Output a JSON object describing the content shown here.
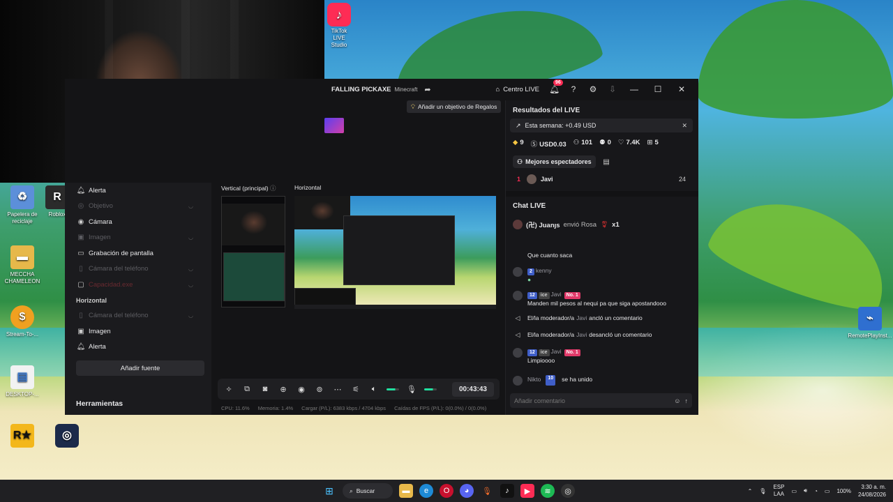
{
  "desktop": {
    "icons": [
      {
        "label": "Papelera de reciclaje",
        "glyph": "♻",
        "color": "#4a7fd6"
      },
      {
        "label": "Roblox",
        "glyph": "R",
        "color": "#2b2b2b"
      },
      {
        "label": "MECCHA CHAMELEON",
        "glyph": "▬",
        "color": "#e7b84a"
      },
      {
        "label": "Stream-To-...",
        "glyph": "$",
        "color": "#f0a020"
      },
      {
        "label": "DESKTOP-...",
        "glyph": "▤",
        "color": "#3a78d0"
      },
      {
        "label": "Rockstar",
        "glyph": "R★",
        "color": "#f3b71b"
      },
      {
        "label": "RemotePlayInst...",
        "glyph": "⌁",
        "color": "#2f6fd0"
      }
    ],
    "tiktok_icon_label": "TikTok LIVE Studio"
  },
  "titlebar": {
    "title": "FALLING PICKAXE",
    "game": "Minecraft",
    "centro_label": "Centro LIVE",
    "notif_count": "96"
  },
  "goal_button": "Añadir un objetivo de Regalos",
  "sources": {
    "vertical_items": [
      {
        "label": "Alerta",
        "icon": "bell-icon",
        "glyph": "🔔︎",
        "state": "normal"
      },
      {
        "label": "Objetivo",
        "icon": "target-icon",
        "glyph": "◎",
        "state": "dim"
      },
      {
        "label": "Cámara",
        "icon": "camera-icon",
        "glyph": "◉",
        "state": "normal"
      },
      {
        "label": "Imagen",
        "icon": "image-icon",
        "glyph": "▣",
        "state": "dim"
      },
      {
        "label": "Grabación de pantalla",
        "icon": "monitor-icon",
        "glyph": "▭",
        "state": "normal"
      },
      {
        "label": "Cámara del teléfono",
        "icon": "phone-icon",
        "glyph": "▯",
        "state": "dim"
      },
      {
        "label": "Capacidad.exe",
        "icon": "window-icon",
        "glyph": "▢",
        "state": "red"
      }
    ],
    "horizontal_label": "Horizontal",
    "horizontal_items": [
      {
        "label": "Cámara del teléfono",
        "icon": "phone-icon",
        "glyph": "▯",
        "state": "dim"
      },
      {
        "label": "Imagen",
        "icon": "image-icon",
        "glyph": "▣",
        "state": "normal"
      },
      {
        "label": "Alerta",
        "icon": "bell-icon",
        "glyph": "🔔︎",
        "state": "normal"
      }
    ],
    "add_source": "Añadir fuente",
    "tools": "Herramientas"
  },
  "previews": {
    "vertical_label": "Vertical (principal)",
    "horizontal_label": "Horizontal"
  },
  "controls": {
    "timer": "00:43:43"
  },
  "statusbar": {
    "cpu": "CPU: 11.6%",
    "mem": "Memoria: 1.4%",
    "load": "Cargar (P/L): 6383 kbps / 4704 kbps",
    "fps": "Caídas de FPS (P/L): 0(0.0%) / 0(0.0%)"
  },
  "results": {
    "title": "Resultados del LIVE",
    "week": "Esta semana: +0.49 USD",
    "stats": [
      {
        "icon": "diamond-icon",
        "glyph": "◆",
        "value": "9"
      },
      {
        "icon": "coin-icon",
        "glyph": "Ⓢ",
        "value": "USD0.03"
      },
      {
        "icon": "viewers-icon",
        "glyph": "⚇",
        "value": "101"
      },
      {
        "icon": "follow-icon",
        "glyph": "⚉",
        "value": "0"
      },
      {
        "icon": "heart-icon",
        "glyph": "♡",
        "value": "7.4K"
      },
      {
        "icon": "gift-icon",
        "glyph": "⊞",
        "value": "5"
      }
    ],
    "best_label": "Mejores espectadores",
    "top_viewer": {
      "rank": "1",
      "name": "Javi",
      "count": "24"
    }
  },
  "chat": {
    "title": "Chat LIVE",
    "gift": {
      "user": "(卍) Juanȷs",
      "action": "envió Rosa",
      "count": "x1"
    },
    "messages": [
      {
        "kind": "text",
        "text": "Que cuanto saca"
      },
      {
        "kind": "user",
        "level": "2",
        "user": "kenny",
        "text": ""
      },
      {
        "kind": "user",
        "level": "12",
        "fan": "ice",
        "user": "Javi",
        "no1": "No. 1",
        "text": "Manden mil pesos al nequi pa que siga apostandooo"
      },
      {
        "kind": "sys",
        "pre": "El/la moderador/a",
        "user": "Javi",
        "post": "ancló un comentario"
      },
      {
        "kind": "sys",
        "pre": "El/la moderador/a",
        "user": "Javi",
        "post": "desancló un comentario"
      },
      {
        "kind": "user",
        "level": "12",
        "fan": "ice",
        "user": "Javi",
        "no1": "No. 1",
        "text": "Limpioooo"
      },
      {
        "kind": "join",
        "user": "Nikto",
        "level": "10",
        "text": "se ha unido"
      }
    ],
    "input_placeholder": "Añadir comentario"
  },
  "taskbar": {
    "search": "Buscar",
    "lang1": "ESP",
    "lang2": "LAA",
    "battery": "100%",
    "time": "3:30 a. m.",
    "date": "24/08/2026"
  }
}
